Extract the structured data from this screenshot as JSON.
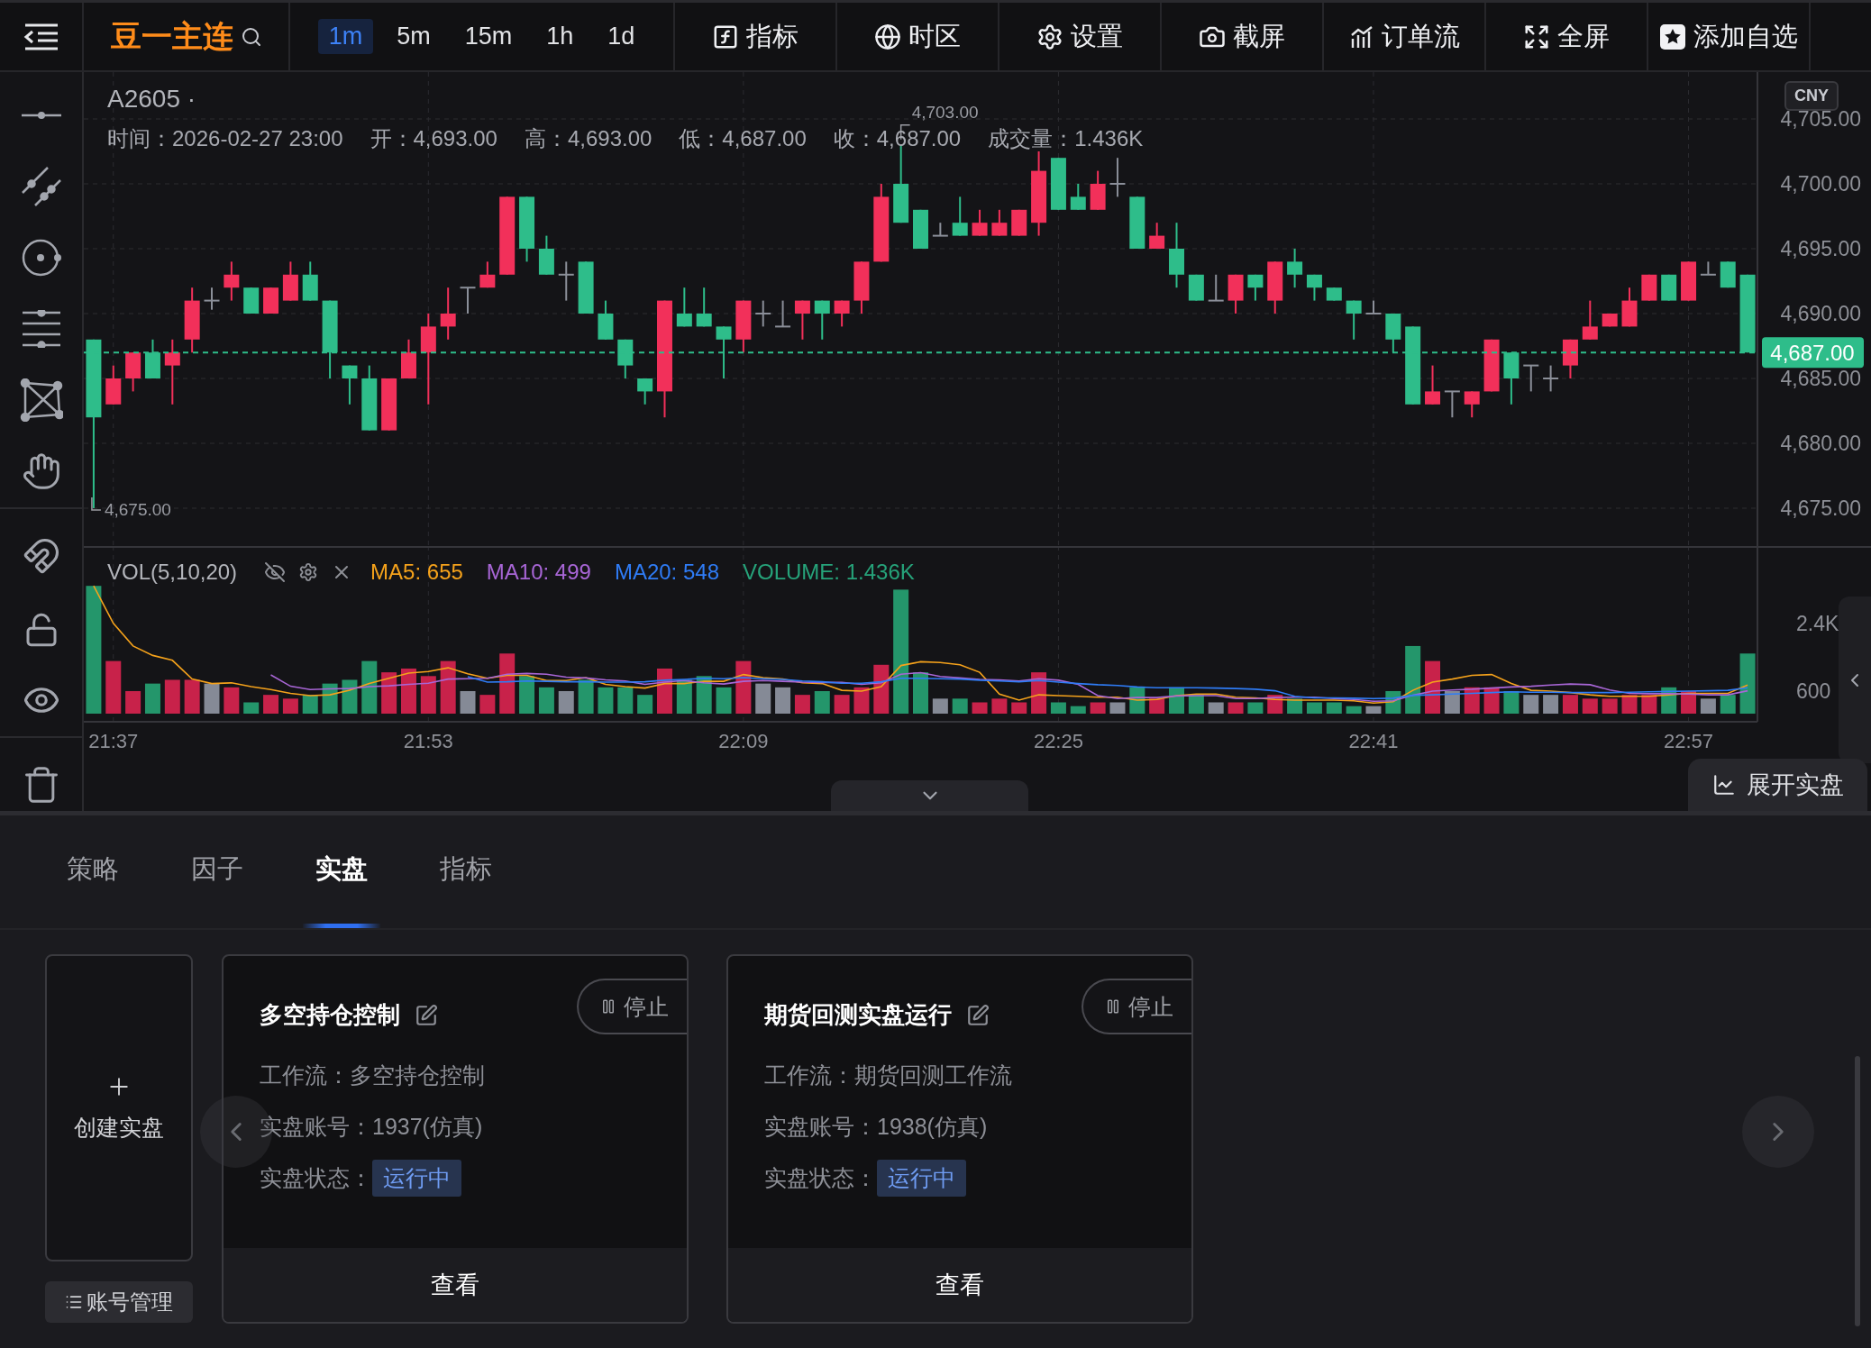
{
  "toolbar": {
    "symbol": "豆一主连",
    "intervals": [
      {
        "label": "1m",
        "selected": true
      },
      {
        "label": "5m",
        "selected": false
      },
      {
        "label": "15m",
        "selected": false
      },
      {
        "label": "1h",
        "selected": false
      },
      {
        "label": "1d",
        "selected": false
      }
    ],
    "buttons": [
      {
        "label": "指标",
        "kind": "indicators"
      },
      {
        "label": "时区",
        "kind": "timezone"
      },
      {
        "label": "设置",
        "kind": "settings"
      },
      {
        "label": "截屏",
        "kind": "screenshot"
      },
      {
        "label": "订单流",
        "kind": "orderflow"
      },
      {
        "label": "全屏",
        "kind": "fullscreen"
      },
      {
        "label": "添加自选",
        "kind": "watchlist"
      }
    ]
  },
  "chart": {
    "title": "A2605 ·",
    "info": [
      "时间：2026-02-27 23:00",
      "开：4,693.00",
      "高：4,693.00",
      "低：4,687.00",
      "收：4,687.00",
      "成交量：1.436K"
    ],
    "currency": "CNY",
    "price_labels": {
      "high": "4,703.00",
      "low": "4,675.00"
    },
    "chart_data": {
      "type": "candlestick",
      "ylim": [
        4675,
        4705
      ],
      "grid": true,
      "categories": [
        null,
        null,
        null,
        null,
        null,
        null,
        null,
        null,
        null,
        null,
        null,
        null,
        null,
        null,
        null,
        null,
        null,
        null,
        null,
        null,
        null,
        null,
        null,
        null,
        null,
        null,
        null,
        null,
        null,
        null,
        null,
        null,
        null,
        null,
        null,
        null,
        null,
        null,
        null,
        null,
        null,
        null,
        null,
        null,
        null,
        null,
        null,
        null,
        null,
        null,
        null,
        null,
        null,
        null,
        null,
        null,
        null,
        null,
        null,
        null,
        null,
        null,
        null,
        null,
        null,
        null,
        null,
        null,
        null,
        null,
        null,
        null,
        null,
        null,
        null,
        null,
        null,
        null,
        null,
        null,
        null,
        null,
        null,
        null,
        null
      ],
      "yticks": [
        {
          "value": 4705,
          "label": "4,705.00"
        },
        {
          "value": 4700,
          "label": "4,700.00"
        },
        {
          "value": 4695,
          "label": "4,695.00"
        },
        {
          "value": 4690,
          "label": "4,690.00"
        },
        {
          "value": 4685,
          "label": "4,685.00"
        },
        {
          "value": 4680,
          "label": "4,680.00"
        },
        {
          "value": 4675,
          "label": "4,675.00"
        }
      ],
      "ref_lines": [
        {
          "axis": "y",
          "value": 4687,
          "label": "4,687.00",
          "color": "#2ebd8a"
        }
      ],
      "ohlc": [
        [
          4688,
          4688,
          4675,
          4682
        ],
        [
          4683,
          4686,
          4683,
          4685
        ],
        [
          4685,
          4687,
          4684,
          4687
        ],
        [
          4687,
          4688,
          4685,
          4685
        ],
        [
          4686,
          4688,
          4683,
          4687
        ],
        [
          4688,
          4692,
          4687,
          4691
        ],
        [
          4691,
          4692,
          4690.3,
          4691
        ],
        [
          4692,
          4694,
          4691,
          4693
        ],
        [
          4692,
          4692,
          4690,
          4690
        ],
        [
          4690,
          4692,
          4690,
          4692
        ],
        [
          4691,
          4694,
          4691,
          4693
        ],
        [
          4693,
          4694,
          4691,
          4691
        ],
        [
          4691,
          4691,
          4685,
          4687
        ],
        [
          4686,
          4686,
          4683,
          4685
        ],
        [
          4685,
          4686,
          4681,
          4681
        ],
        [
          4681,
          4685,
          4681,
          4685
        ],
        [
          4685,
          4688,
          4685,
          4687
        ],
        [
          4687,
          4690,
          4683,
          4689
        ],
        [
          4689,
          4692,
          4688,
          4690
        ],
        [
          4692,
          4692,
          4690,
          4692
        ],
        [
          4692,
          4694,
          4692,
          4693
        ],
        [
          4693,
          4699,
          4693,
          4699
        ],
        [
          4699,
          4699,
          4694,
          4695
        ],
        [
          4695,
          4696,
          4693,
          4693
        ],
        [
          4693,
          4694,
          4691,
          4693
        ],
        [
          4694,
          4694,
          4690,
          4690
        ],
        [
          4690,
          4691,
          4688,
          4688
        ],
        [
          4688,
          4688,
          4685,
          4686
        ],
        [
          4685,
          4685,
          4683,
          4684
        ],
        [
          4684,
          4691,
          4682,
          4691
        ],
        [
          4690,
          4692,
          4689,
          4689
        ],
        [
          4690,
          4692,
          4689,
          4689
        ],
        [
          4689,
          4689,
          4685,
          4688
        ],
        [
          4688,
          4691,
          4687,
          4691
        ],
        [
          4690,
          4691,
          4689,
          4690
        ],
        [
          4689,
          4691,
          4689,
          4689
        ],
        [
          4690,
          4691,
          4688,
          4691
        ],
        [
          4691,
          4691,
          4688,
          4690
        ],
        [
          4690,
          4691,
          4689,
          4691
        ],
        [
          4691,
          4694,
          4690,
          4694
        ],
        [
          4694,
          4700,
          4694,
          4699
        ],
        [
          4700,
          4703,
          4697,
          4697
        ],
        [
          4698,
          4698,
          4695,
          4695
        ],
        [
          4696,
          4697,
          4696,
          4696
        ],
        [
          4697,
          4699,
          4696,
          4696
        ],
        [
          4696,
          4698,
          4696,
          4697
        ],
        [
          4696,
          4698,
          4696,
          4697
        ],
        [
          4696,
          4698,
          4696,
          4698
        ],
        [
          4697,
          4702.5,
          4696,
          4701
        ],
        [
          4702,
          4702,
          4698,
          4698
        ],
        [
          4699,
          4700,
          4698,
          4698
        ],
        [
          4698,
          4701,
          4698,
          4700
        ],
        [
          4700,
          4702,
          4699,
          4700
        ],
        [
          4699,
          4699,
          4695,
          4695
        ],
        [
          4695,
          4697,
          4695,
          4696
        ],
        [
          4695,
          4697,
          4692,
          4693
        ],
        [
          4693,
          4693,
          4691,
          4691
        ],
        [
          4691,
          4693,
          4691,
          4691
        ],
        [
          4691,
          4693,
          4690,
          4693
        ],
        [
          4693,
          4693,
          4691,
          4692
        ],
        [
          4691,
          4694,
          4690,
          4694
        ],
        [
          4694,
          4695,
          4692,
          4693
        ],
        [
          4693,
          4693,
          4691,
          4692
        ],
        [
          4692,
          4692,
          4691,
          4691
        ],
        [
          4691,
          4691,
          4688,
          4690
        ],
        [
          4690,
          4691,
          4690,
          4690
        ],
        [
          4690,
          4690,
          4687,
          4688
        ],
        [
          4689,
          4689,
          4683,
          4683
        ],
        [
          4683,
          4686,
          4683,
          4684
        ],
        [
          4684,
          4684,
          4682,
          4684
        ],
        [
          4683,
          4684,
          4682,
          4684
        ],
        [
          4684,
          4688,
          4684,
          4688
        ],
        [
          4687,
          4687,
          4683,
          4685
        ],
        [
          4686,
          4686,
          4684,
          4686
        ],
        [
          4685,
          4686,
          4684,
          4685
        ],
        [
          4686,
          4688,
          4685,
          4688
        ],
        [
          4688,
          4691,
          4688,
          4689
        ],
        [
          4689,
          4690,
          4689,
          4690
        ],
        [
          4689,
          4692,
          4689,
          4691
        ],
        [
          4691,
          4693,
          4691,
          4693
        ],
        [
          4693,
          4693,
          4691,
          4691
        ],
        [
          4691,
          4694,
          4691,
          4694
        ],
        [
          4693,
          4694,
          4693,
          4693
        ],
        [
          4694,
          4694,
          4692,
          4692
        ],
        [
          4693,
          4693,
          4687,
          4687
        ]
      ]
    }
  },
  "volume": {
    "title": "VOL(5,10,20)",
    "legend": [
      {
        "text": "MA5: 655",
        "color": "#f5a21b"
      },
      {
        "text": "MA10: 499",
        "color": "#a866d6"
      },
      {
        "text": "MA20: 548",
        "color": "#2f7cf6"
      },
      {
        "text": "VOLUME: 1.436K",
        "color": "#26a37a"
      }
    ],
    "chart_data": {
      "type": "bar",
      "ylim": [
        0,
        4460
      ],
      "grid": true,
      "categories": [
        null,
        "21:37",
        null,
        null,
        null,
        null,
        null,
        null,
        null,
        null,
        null,
        null,
        null,
        null,
        null,
        null,
        null,
        "21:53",
        null,
        null,
        null,
        null,
        null,
        null,
        null,
        null,
        null,
        null,
        null,
        null,
        null,
        null,
        null,
        "22:09",
        null,
        null,
        null,
        null,
        null,
        null,
        null,
        null,
        null,
        null,
        null,
        null,
        null,
        null,
        null,
        "22:25",
        null,
        null,
        null,
        null,
        null,
        null,
        null,
        null,
        null,
        null,
        null,
        null,
        null,
        null,
        null,
        "22:41",
        null,
        null,
        null,
        null,
        null,
        null,
        null,
        null,
        null,
        null,
        null,
        null,
        null,
        null,
        null,
        "22:57",
        null,
        null,
        null
      ],
      "yticks": [
        {
          "value": 600,
          "label": "600"
        },
        {
          "value": 2400,
          "label": "2.4K"
        }
      ],
      "series": [
        {
          "type": "bar",
          "colors": [
            "#24966b",
            "#c8224a",
            "#c8224a",
            "#24966b",
            "#c8224a",
            "#c8224a",
            "#858a96",
            "#c8224a",
            "#24966b",
            "#c8224a",
            "#c8224a",
            "#24966b",
            "#24966b",
            "#24966b",
            "#24966b",
            "#c8224a",
            "#c8224a",
            "#c8224a",
            "#c8224a",
            "#858a96",
            "#c8224a",
            "#c8224a",
            "#24966b",
            "#24966b",
            "#858a96",
            "#24966b",
            "#24966b",
            "#24966b",
            "#24966b",
            "#c8224a",
            "#24966b",
            "#24966b",
            "#24966b",
            "#c8224a",
            "#858a96",
            "#858a96",
            "#c8224a",
            "#24966b",
            "#c8224a",
            "#c8224a",
            "#c8224a",
            "#24966b",
            "#24966b",
            "#858a96",
            "#24966b",
            "#c8224a",
            "#c8224a",
            "#c8224a",
            "#c8224a",
            "#24966b",
            "#24966b",
            "#c8224a",
            "#858a96",
            "#24966b",
            "#c8224a",
            "#24966b",
            "#24966b",
            "#858a96",
            "#c8224a",
            "#24966b",
            "#c8224a",
            "#24966b",
            "#24966b",
            "#24966b",
            "#24966b",
            "#858a96",
            "#24966b",
            "#24966b",
            "#c8224a",
            "#858a96",
            "#c8224a",
            "#c8224a",
            "#24966b",
            "#858a96",
            "#858a96",
            "#c8224a",
            "#c8224a",
            "#c8224a",
            "#c8224a",
            "#c8224a",
            "#24966b",
            "#c8224a",
            "#858a96",
            "#24966b",
            "#24966b"
          ],
          "values": [
            3400,
            1400,
            600,
            800,
            900,
            900,
            800,
            700,
            300,
            500,
            400,
            500,
            800,
            900,
            1400,
            1100,
            1200,
            1000,
            1400,
            600,
            500,
            1600,
            1000,
            700,
            600,
            900,
            700,
            700,
            500,
            1200,
            900,
            1000,
            700,
            1400,
            800,
            700,
            500,
            600,
            500,
            700,
            1300,
            3300,
            1100,
            400,
            400,
            300,
            400,
            300,
            1100,
            300,
            200,
            300,
            300,
            700,
            400,
            700,
            500,
            300,
            300,
            300,
            500,
            400,
            300,
            300,
            200,
            200,
            600,
            1800,
            1400,
            600,
            700,
            700,
            600,
            500,
            500,
            500,
            400,
            400,
            500,
            500,
            700,
            600,
            400,
            500,
            1600
          ]
        },
        {
          "type": "line",
          "color": "#f5a21b",
          "values": [
            3400,
            2400,
            1800,
            1550,
            1420,
            920,
            800,
            820,
            720,
            640,
            540,
            480,
            500,
            620,
            800,
            940,
            1080,
            1120,
            1220,
            1060,
            940,
            1020,
            1020,
            880,
            880,
            960,
            780,
            720,
            680,
            800,
            800,
            860,
            860,
            1040,
            960,
            920,
            820,
            800,
            620,
            600,
            720,
            1280,
            1380,
            1360,
            1300,
            1100,
            520,
            360,
            500,
            480,
            460,
            440,
            440,
            360,
            380,
            480,
            520,
            520,
            440,
            420,
            380,
            360,
            360,
            360,
            340,
            280,
            320,
            620,
            840,
            920,
            1020,
            1040,
            800,
            620,
            600,
            560,
            500,
            460,
            460,
            460,
            500,
            540,
            540,
            540,
            760
          ]
        },
        {
          "type": "line",
          "color": "#a866d6",
          "values": [
            null,
            null,
            null,
            null,
            null,
            null,
            null,
            null,
            null,
            1030,
            730,
            640,
            660,
            670,
            720,
            740,
            780,
            810,
            920,
            930,
            940,
            1050,
            1070,
            1050,
            970,
            950,
            900,
            870,
            780,
            840,
            880,
            820,
            790,
            860,
            880,
            860,
            840,
            830,
            830,
            780,
            820,
            1050,
            1090,
            990,
            950,
            910,
            900,
            870,
            930,
            890,
            780,
            480,
            400,
            430,
            430,
            470,
            480,
            480,
            400,
            400,
            430,
            440,
            440,
            400,
            380,
            330,
            340,
            490,
            600,
            630,
            650,
            680,
            710,
            730,
            760,
            790,
            770,
            630,
            540,
            530,
            530,
            520,
            500,
            500,
            610
          ]
        },
        {
          "type": "line",
          "color": "#2f7cf6",
          "values": [
            null,
            null,
            null,
            null,
            null,
            null,
            null,
            null,
            null,
            null,
            null,
            null,
            null,
            null,
            null,
            null,
            null,
            null,
            null,
            980,
            840,
            850,
            870,
            860,
            850,
            850,
            840,
            840,
            850,
            890,
            910,
            940,
            930,
            960,
            930,
            910,
            870,
            850,
            810,
            810,
            850,
            940,
            940,
            930,
            920,
            890,
            870,
            850,
            880,
            840,
            800,
            770,
            750,
            710,
            690,
            690,
            690,
            680,
            670,
            650,
            610,
            460,
            420,
            420,
            410,
            400,
            410,
            490,
            500,
            520,
            540,
            560,
            580,
            570,
            570,
            560,
            560,
            560,
            570,
            580,
            590,
            600,
            610,
            620,
            690
          ]
        }
      ]
    }
  },
  "expand_button": "展开实盘",
  "bottom_tabs": [
    {
      "label": "策略",
      "selected": false
    },
    {
      "label": "因子",
      "selected": false
    },
    {
      "label": "实盘",
      "selected": true
    },
    {
      "label": "指标",
      "selected": false
    }
  ],
  "create_card": "创建实盘",
  "account_button": "账号管理",
  "cards": [
    {
      "title": "多空持仓控制",
      "stop": "停止",
      "fields": [
        {
          "label": "工作流：",
          "value": "多空持仓控制",
          "kind": "text"
        },
        {
          "label": "实盘账号：",
          "value": "1937(仿真)",
          "kind": "text"
        },
        {
          "label": "实盘状态：",
          "value": "运行中",
          "kind": "tag"
        }
      ],
      "footer": "查看"
    },
    {
      "title": "期货回测实盘运行",
      "stop": "停止",
      "fields": [
        {
          "label": "工作流：",
          "value": "期货回测工作流",
          "kind": "text"
        },
        {
          "label": "实盘账号：",
          "value": "1938(仿真)",
          "kind": "text"
        },
        {
          "label": "实盘状态：",
          "value": "运行中",
          "kind": "tag"
        }
      ],
      "footer": "查看"
    }
  ]
}
